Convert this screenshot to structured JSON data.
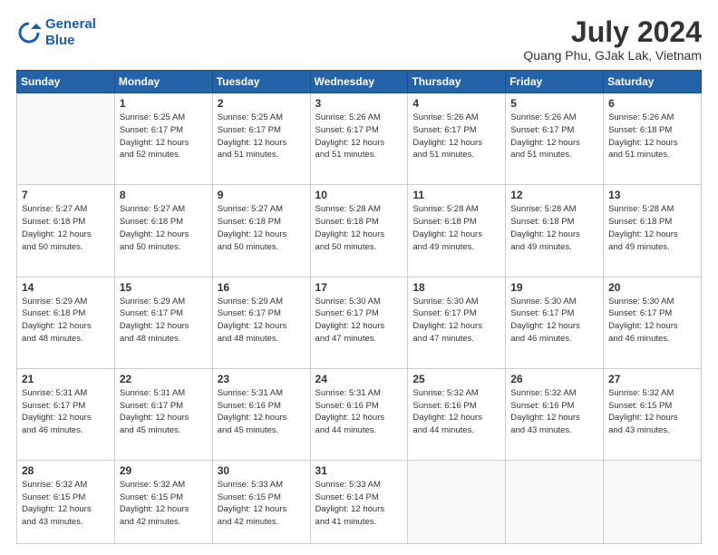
{
  "header": {
    "logo_line1": "General",
    "logo_line2": "Blue",
    "title": "July 2024",
    "subtitle": "Quang Phu, GJak Lak, Vietnam"
  },
  "days_of_week": [
    "Sunday",
    "Monday",
    "Tuesday",
    "Wednesday",
    "Thursday",
    "Friday",
    "Saturday"
  ],
  "weeks": [
    [
      {
        "day": "",
        "info": ""
      },
      {
        "day": "1",
        "info": "Sunrise: 5:25 AM\nSunset: 6:17 PM\nDaylight: 12 hours\nand 52 minutes."
      },
      {
        "day": "2",
        "info": "Sunrise: 5:25 AM\nSunset: 6:17 PM\nDaylight: 12 hours\nand 51 minutes."
      },
      {
        "day": "3",
        "info": "Sunrise: 5:26 AM\nSunset: 6:17 PM\nDaylight: 12 hours\nand 51 minutes."
      },
      {
        "day": "4",
        "info": "Sunrise: 5:26 AM\nSunset: 6:17 PM\nDaylight: 12 hours\nand 51 minutes."
      },
      {
        "day": "5",
        "info": "Sunrise: 5:26 AM\nSunset: 6:17 PM\nDaylight: 12 hours\nand 51 minutes."
      },
      {
        "day": "6",
        "info": "Sunrise: 5:26 AM\nSunset: 6:18 PM\nDaylight: 12 hours\nand 51 minutes."
      }
    ],
    [
      {
        "day": "7",
        "info": "Sunrise: 5:27 AM\nSunset: 6:18 PM\nDaylight: 12 hours\nand 50 minutes."
      },
      {
        "day": "8",
        "info": "Sunrise: 5:27 AM\nSunset: 6:18 PM\nDaylight: 12 hours\nand 50 minutes."
      },
      {
        "day": "9",
        "info": "Sunrise: 5:27 AM\nSunset: 6:18 PM\nDaylight: 12 hours\nand 50 minutes."
      },
      {
        "day": "10",
        "info": "Sunrise: 5:28 AM\nSunset: 6:18 PM\nDaylight: 12 hours\nand 50 minutes."
      },
      {
        "day": "11",
        "info": "Sunrise: 5:28 AM\nSunset: 6:18 PM\nDaylight: 12 hours\nand 49 minutes."
      },
      {
        "day": "12",
        "info": "Sunrise: 5:28 AM\nSunset: 6:18 PM\nDaylight: 12 hours\nand 49 minutes."
      },
      {
        "day": "13",
        "info": "Sunrise: 5:28 AM\nSunset: 6:18 PM\nDaylight: 12 hours\nand 49 minutes."
      }
    ],
    [
      {
        "day": "14",
        "info": "Sunrise: 5:29 AM\nSunset: 6:18 PM\nDaylight: 12 hours\nand 48 minutes."
      },
      {
        "day": "15",
        "info": "Sunrise: 5:29 AM\nSunset: 6:17 PM\nDaylight: 12 hours\nand 48 minutes."
      },
      {
        "day": "16",
        "info": "Sunrise: 5:29 AM\nSunset: 6:17 PM\nDaylight: 12 hours\nand 48 minutes."
      },
      {
        "day": "17",
        "info": "Sunrise: 5:30 AM\nSunset: 6:17 PM\nDaylight: 12 hours\nand 47 minutes."
      },
      {
        "day": "18",
        "info": "Sunrise: 5:30 AM\nSunset: 6:17 PM\nDaylight: 12 hours\nand 47 minutes."
      },
      {
        "day": "19",
        "info": "Sunrise: 5:30 AM\nSunset: 6:17 PM\nDaylight: 12 hours\nand 46 minutes."
      },
      {
        "day": "20",
        "info": "Sunrise: 5:30 AM\nSunset: 6:17 PM\nDaylight: 12 hours\nand 46 minutes."
      }
    ],
    [
      {
        "day": "21",
        "info": "Sunrise: 5:31 AM\nSunset: 6:17 PM\nDaylight: 12 hours\nand 46 minutes."
      },
      {
        "day": "22",
        "info": "Sunrise: 5:31 AM\nSunset: 6:17 PM\nDaylight: 12 hours\nand 45 minutes."
      },
      {
        "day": "23",
        "info": "Sunrise: 5:31 AM\nSunset: 6:16 PM\nDaylight: 12 hours\nand 45 minutes."
      },
      {
        "day": "24",
        "info": "Sunrise: 5:31 AM\nSunset: 6:16 PM\nDaylight: 12 hours\nand 44 minutes."
      },
      {
        "day": "25",
        "info": "Sunrise: 5:32 AM\nSunset: 6:16 PM\nDaylight: 12 hours\nand 44 minutes."
      },
      {
        "day": "26",
        "info": "Sunrise: 5:32 AM\nSunset: 6:16 PM\nDaylight: 12 hours\nand 43 minutes."
      },
      {
        "day": "27",
        "info": "Sunrise: 5:32 AM\nSunset: 6:15 PM\nDaylight: 12 hours\nand 43 minutes."
      }
    ],
    [
      {
        "day": "28",
        "info": "Sunrise: 5:32 AM\nSunset: 6:15 PM\nDaylight: 12 hours\nand 43 minutes."
      },
      {
        "day": "29",
        "info": "Sunrise: 5:32 AM\nSunset: 6:15 PM\nDaylight: 12 hours\nand 42 minutes."
      },
      {
        "day": "30",
        "info": "Sunrise: 5:33 AM\nSunset: 6:15 PM\nDaylight: 12 hours\nand 42 minutes."
      },
      {
        "day": "31",
        "info": "Sunrise: 5:33 AM\nSunset: 6:14 PM\nDaylight: 12 hours\nand 41 minutes."
      },
      {
        "day": "",
        "info": ""
      },
      {
        "day": "",
        "info": ""
      },
      {
        "day": "",
        "info": ""
      }
    ]
  ]
}
